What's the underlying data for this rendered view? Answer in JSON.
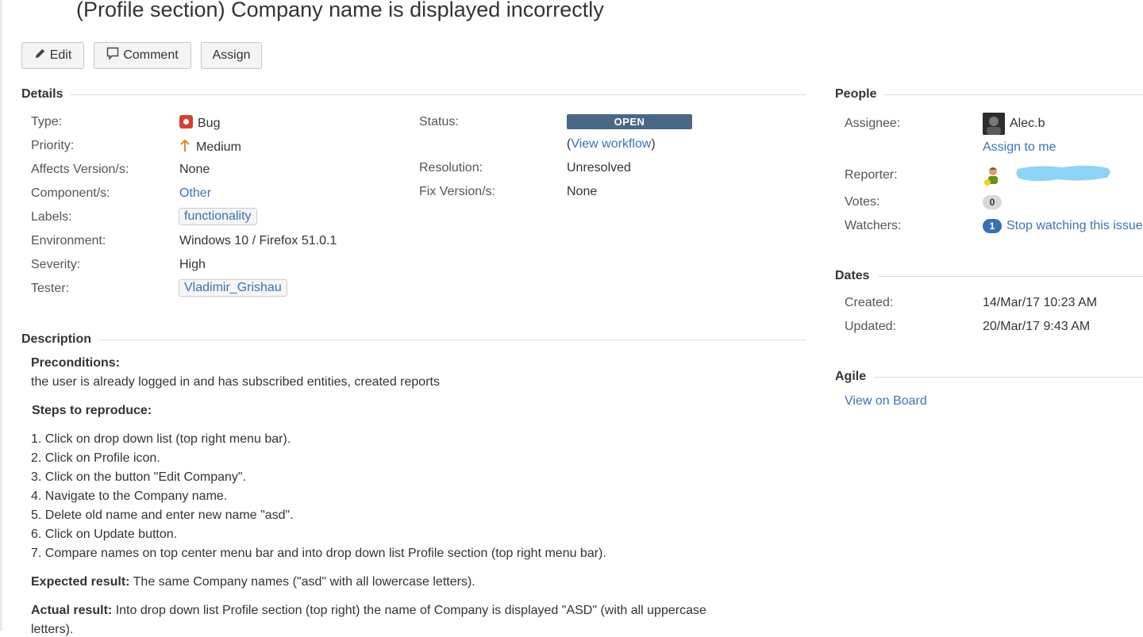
{
  "issue": {
    "title": "(Profile section) Company name is displayed incorrectly"
  },
  "toolbar": {
    "edit_label": "Edit",
    "comment_label": "Comment",
    "assign_label": "Assign"
  },
  "details": {
    "heading": "Details",
    "type": {
      "label": "Type:",
      "value": "Bug",
      "icon": "bug-icon"
    },
    "priority": {
      "label": "Priority:",
      "value": "Medium",
      "icon": "arrow-up-icon"
    },
    "affects": {
      "label": "Affects Version/s:",
      "value": "None"
    },
    "component": {
      "label": "Component/s:",
      "value": "Other"
    },
    "labels": {
      "label": "Labels:",
      "value": "functionality"
    },
    "environment": {
      "label": "Environment:",
      "value": "Windows 10 / Firefox 51.0.1"
    },
    "severity": {
      "label": "Severity:",
      "value": "High"
    },
    "tester": {
      "label": "Tester:",
      "value": "Vladimir_Grishau"
    },
    "status": {
      "label": "Status:",
      "value": "OPEN",
      "workflow_open": "(",
      "workflow_link": "View workflow",
      "workflow_close": ")"
    },
    "resolution": {
      "label": "Resolution:",
      "value": "Unresolved"
    },
    "fix": {
      "label": "Fix Version/s:",
      "value": "None"
    }
  },
  "description": {
    "heading": "Description",
    "preconditions_label": "Preconditions:",
    "preconditions_text": "the user is already logged in and has subscribed entities, created reports",
    "steps_label": "Steps to reproduce:",
    "steps": [
      "1. Click on drop down list (top right menu bar).",
      "2. Click on Profile icon.",
      "3. Click on the button \"Edit Company\".",
      "4. Navigate to the Company name.",
      "5. Delete old name and enter new name \"asd\".",
      "6. Click on Update button.",
      "7. Compare names on top center menu bar and into drop down list Profile section (top right menu bar)."
    ],
    "expected_label": "Expected result:",
    "expected_text": " The same Company names (\"asd\" with all lowercase letters).",
    "actual_label": "Actual result:",
    "actual_text": " Into drop down list Profile section (top right) the name of Company is displayed \"ASD\" (with all uppercase",
    "actual_text_cont": "letters)."
  },
  "people": {
    "heading": "People",
    "assignee_label": "Assignee:",
    "assignee_name": "Alec.b",
    "assign_to_me": "Assign to me",
    "reporter_label": "Reporter:",
    "votes_label": "Votes:",
    "votes_count": "0",
    "watchers_label": "Watchers:",
    "watchers_count": "1",
    "stop_watching": "Stop watching this issue"
  },
  "dates": {
    "heading": "Dates",
    "created_label": "Created:",
    "created_value": "14/Mar/17 10:23 AM",
    "updated_label": "Updated:",
    "updated_value": "20/Mar/17 9:43 AM"
  },
  "agile": {
    "heading": "Agile",
    "view_on_board": "View on Board"
  },
  "colors": {
    "link": "#3b73af",
    "status_open": "#4a6785",
    "bug": "#d04437",
    "priority_medium": "#e08a2c",
    "watch_badge": "#3572b0"
  }
}
